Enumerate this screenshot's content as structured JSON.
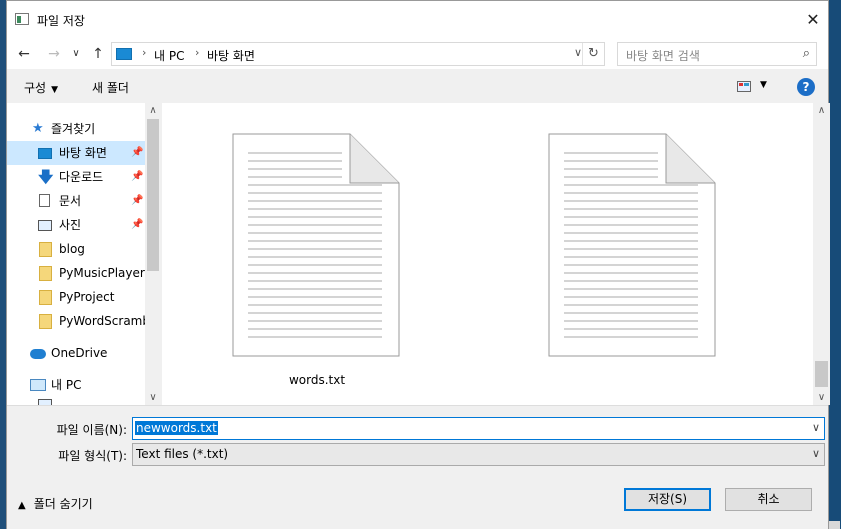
{
  "dialog": {
    "title": "파일 저장"
  },
  "nav": {
    "back_icon": "←",
    "forward_icon": "→",
    "dropdown_icon": "∨",
    "up_icon": "↑",
    "breadcrumb": [
      "내 PC",
      "바탕 화면"
    ],
    "separator": "›",
    "refresh_icon": "↻",
    "search_placeholder": "바탕 화면 검색",
    "search_icon": "⌕"
  },
  "toolbar": {
    "organize": "구성",
    "new_folder": "새 폴더",
    "help": "?"
  },
  "sidebar": {
    "items": [
      {
        "label": "즐겨찾기",
        "icon": "star-icon",
        "pinned": false
      },
      {
        "label": "바탕 화면",
        "icon": "desktop-icon",
        "pinned": true,
        "selected": true
      },
      {
        "label": "다운로드",
        "icon": "download-icon",
        "pinned": true
      },
      {
        "label": "문서",
        "icon": "document-icon",
        "pinned": true
      },
      {
        "label": "사진",
        "icon": "pictures-icon",
        "pinned": true
      },
      {
        "label": "blog",
        "icon": "folder-icon",
        "pinned": false
      },
      {
        "label": "PyMusicPlayerPr",
        "icon": "folder-icon",
        "pinned": false
      },
      {
        "label": "PyProject",
        "icon": "folder-icon",
        "pinned": false
      },
      {
        "label": "PyWordScrambl",
        "icon": "folder-icon",
        "pinned": false
      },
      {
        "label": "OneDrive",
        "icon": "onedrive-icon",
        "pinned": false
      },
      {
        "label": "내 PC",
        "icon": "computer-icon",
        "pinned": false
      }
    ]
  },
  "files": [
    {
      "name": "words.txt"
    },
    {
      "name": ""
    }
  ],
  "form": {
    "filename_label": "파일 이름(N):",
    "filename_value": "newwords.txt",
    "filetype_label": "파일 형식(T):",
    "filetype_value": "Text files (*.txt)"
  },
  "footer": {
    "hide_folders": "폴더 숨기기",
    "save": "저장(S)",
    "cancel": "취소"
  }
}
